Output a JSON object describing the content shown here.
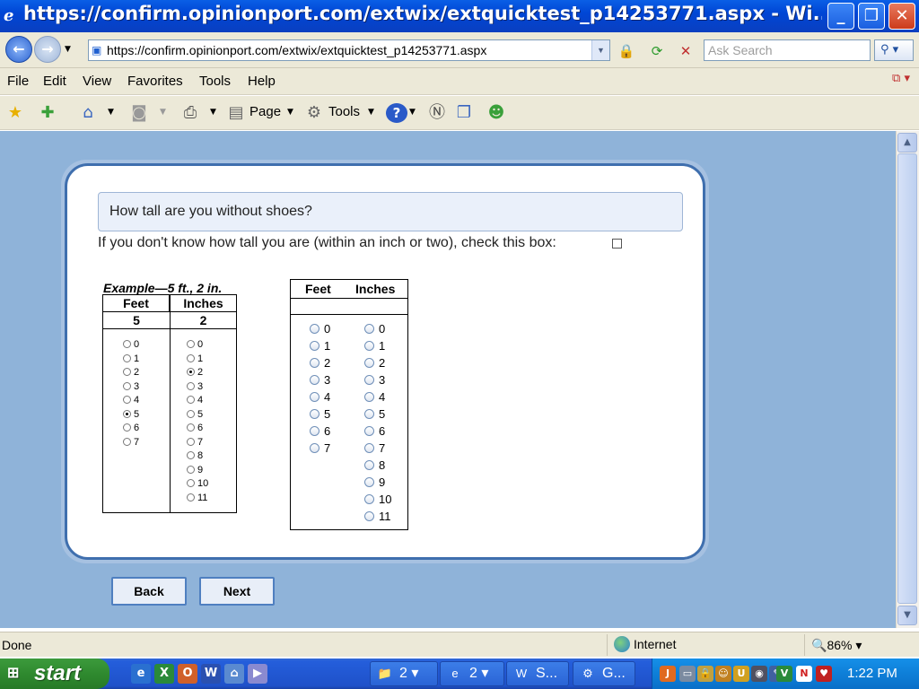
{
  "window": {
    "title": "https://confirm.opinionport.com/extwix/extquicktest_p14253771.aspx - Wi...",
    "minimize": "_",
    "maximize": "❐",
    "close": "✕"
  },
  "address_bar": {
    "url": "https://confirm.opinionport.com/extwix/extquicktest_p14253771.aspx",
    "search_placeholder": "Ask Search"
  },
  "menu": [
    "File",
    "Edit",
    "View",
    "Favorites",
    "Tools",
    "Help"
  ],
  "toolbar": {
    "page_label": "Page",
    "tools_label": "Tools"
  },
  "survey": {
    "question": "How tall are you without shoes?",
    "unknown_label": "If you don't know how tall you are (within an inch or two), check this box:",
    "example": {
      "caption": "Example—5 ft., 2 in.",
      "feet_header": "Feet",
      "inches_header": "Inches",
      "feet_value": "5",
      "inches_value": "2",
      "feet_options": [
        "0",
        "1",
        "2",
        "3",
        "4",
        "5",
        "6",
        "7"
      ],
      "inches_options": [
        "0",
        "1",
        "2",
        "3",
        "4",
        "5",
        "6",
        "7",
        "8",
        "9",
        "10",
        "11"
      ],
      "feet_selected": "5",
      "inches_selected": "2"
    },
    "answer": {
      "feet_header": "Feet",
      "inches_header": "Inches",
      "feet_options": [
        "0",
        "1",
        "2",
        "3",
        "4",
        "5",
        "6",
        "7"
      ],
      "inches_options": [
        "0",
        "1",
        "2",
        "3",
        "4",
        "5",
        "6",
        "7",
        "8",
        "9",
        "10",
        "11"
      ]
    },
    "back_label": "Back",
    "next_label": "Next"
  },
  "status": {
    "text": "Done",
    "zone": "Internet",
    "zoom": "86%"
  },
  "taskbar": {
    "start_label": "start",
    "tasks": [
      {
        "icon": "folder-icon",
        "label": "2"
      },
      {
        "icon": "ie-icon",
        "label": "2"
      },
      {
        "icon": "word-icon",
        "label": "S..."
      },
      {
        "icon": "program-icon",
        "label": "G..."
      }
    ],
    "clock": "1:22 PM"
  }
}
